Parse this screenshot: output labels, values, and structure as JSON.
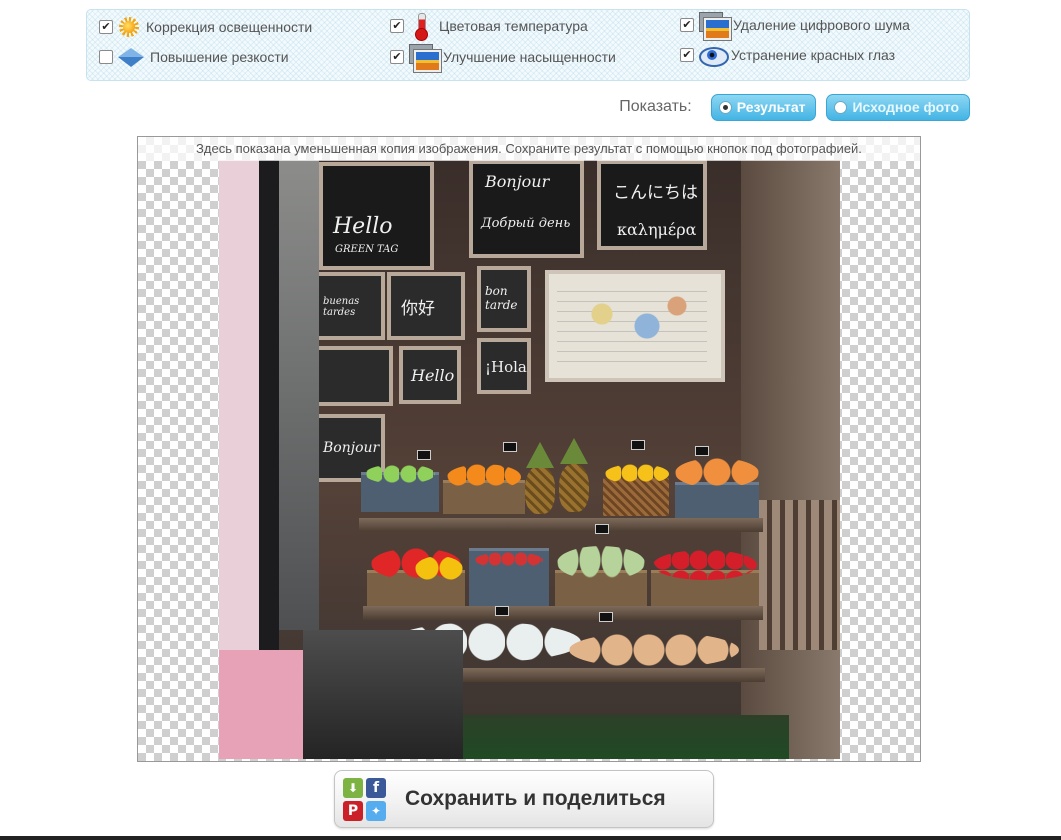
{
  "options": [
    {
      "label": "Коррекция освещенности",
      "checked": true,
      "icon": "sun-icon"
    },
    {
      "label": "Цветовая температура",
      "checked": true,
      "icon": "thermometer-icon"
    },
    {
      "label": "Удаление цифрового шума",
      "checked": true,
      "icon": "photo-noise-icon"
    },
    {
      "label": "Повышение резкости",
      "checked": false,
      "icon": "diamond-icon"
    },
    {
      "label": "Улучшение насыщенности",
      "checked": true,
      "icon": "photo-saturation-icon"
    },
    {
      "label": "Устранение красных глаз",
      "checked": true,
      "icon": "eye-icon"
    }
  ],
  "show": {
    "label": "Показать:",
    "result_label": "Результат",
    "original_label": "Исходное фото",
    "selected": "result"
  },
  "preview": {
    "notice": "Здесь показана уменьшенная копия изображения. Сохраните результат с помощью кнопок под фотографией.",
    "chalk_texts": [
      "Hello",
      "GREEN TAG",
      "Bonjour",
      "Добрый день",
      "こんにちは",
      "καλημέρα",
      "buenas tardes",
      "你好",
      "bon tarde",
      "Hello",
      "¡Hola",
      "Bonjour"
    ]
  },
  "save": {
    "label": "Сохранить и поделиться",
    "icons": [
      "download-icon",
      "facebook-icon",
      "pinterest-icon",
      "twitter-icon"
    ]
  },
  "colors": {
    "accent": "#43b4e4",
    "panel_bg": "#f3fafd",
    "panel_border": "#c6e3ef"
  }
}
